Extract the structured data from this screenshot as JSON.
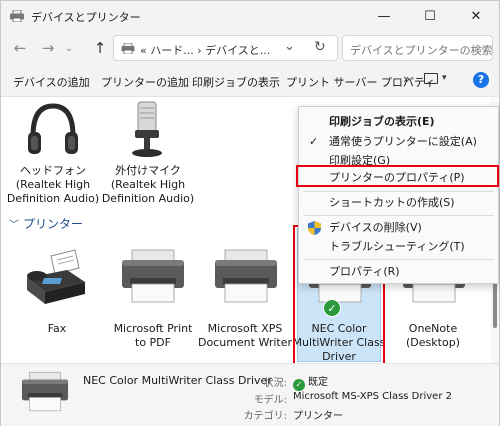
{
  "window": {
    "title": "デバイスとプリンター",
    "minimize": "—",
    "maximize": "☐",
    "close": "✕"
  },
  "nav": {
    "back": "←",
    "forward": "→",
    "dropdown": "⌄",
    "up": "↑",
    "address_text": "«  ハード...  ›  デバイスと...",
    "address_dropdown": "⌄",
    "refresh": "↻",
    "search_placeholder": "デバイスとプリンターの検索"
  },
  "commands": {
    "add_device": "デバイスの追加",
    "add_printer": "プリンターの追加",
    "print_jobs": "印刷ジョブの表示",
    "print_server": "プリント サーバー プロパティ",
    "more": "»",
    "view_drop": "▾",
    "help": "?"
  },
  "devices": [
    {
      "label": "ヘッドフォン\n(Realtek High\nDefinition Audio)",
      "icon": "headphones-icon"
    },
    {
      "label": "外付けマイク\n(Realtek High\nDefinition Audio)",
      "icon": "microphone-icon"
    }
  ],
  "printers_section": {
    "chevron": "﹀",
    "title": "プリンター"
  },
  "printers": [
    {
      "label": "Fax",
      "icon": "fax-icon"
    },
    {
      "label": "Microsoft Print\nto PDF",
      "icon": "printer-icon"
    },
    {
      "label": "Microsoft XPS\nDocument Writer",
      "icon": "printer-icon"
    },
    {
      "label": "NEC Color\nMultiWriter Class\nDriver",
      "icon": "printer-icon",
      "selected": true,
      "default": true
    },
    {
      "label": "OneNote\n(Desktop)",
      "icon": "printer-icon"
    }
  ],
  "default_check": "✓",
  "context_menu": {
    "items": [
      {
        "label": "印刷ジョブの表示(E)",
        "bold": true
      },
      {
        "label": "通常使うプリンターに設定(A)",
        "mark": "✓"
      },
      {
        "label": "印刷設定(G)"
      },
      {
        "label": "プリンターのプロパティ(P)",
        "highlighted": true
      },
      {
        "label": "ショートカットの作成(S)"
      },
      {
        "label": "デバイスの削除(V)",
        "shield": true
      },
      {
        "label": "トラブルシューティング(T)"
      },
      {
        "label": "プロパティ(R)"
      }
    ]
  },
  "details": {
    "name": "NEC Color MultiWriter Class Driver",
    "status_key": "状況:",
    "status_val": "既定",
    "model_key": "モデル:",
    "model_val": "Microsoft MS-XPS Class Driver 2",
    "category_key": "カテゴリ:",
    "category_val": "プリンター"
  },
  "colors": {
    "highlight_red": "#e60012",
    "selection_blue": "#cce4f7",
    "accent_blue": "#1a73e8",
    "ok_green": "#2b9a3c"
  }
}
